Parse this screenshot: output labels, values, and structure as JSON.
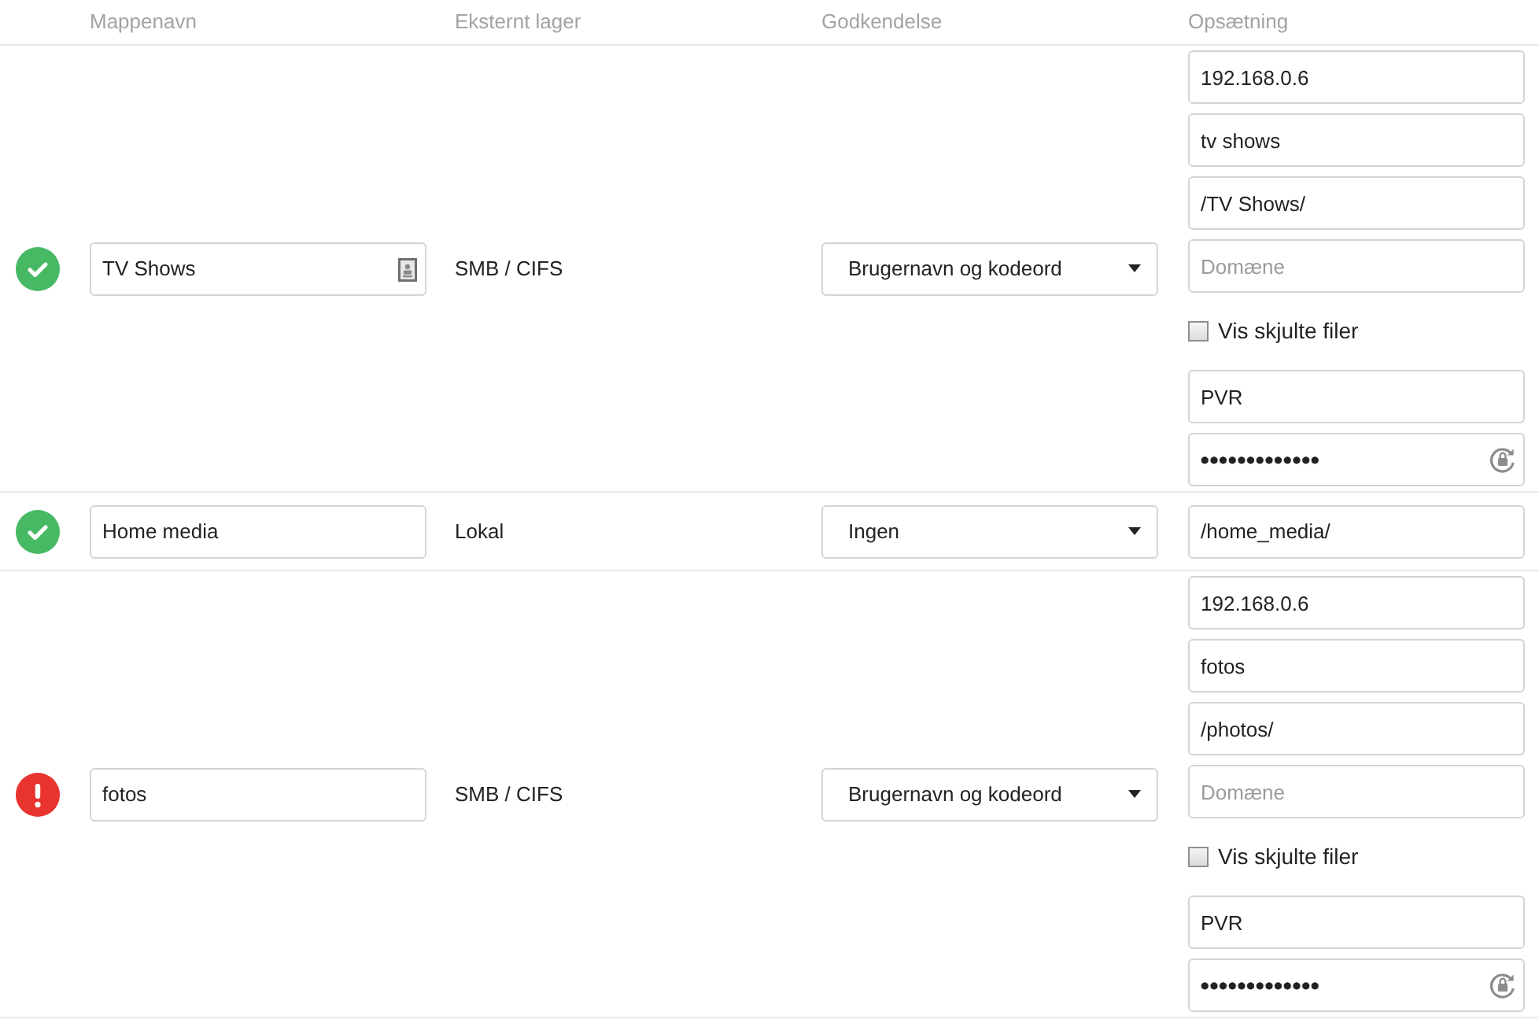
{
  "table": {
    "columns": [
      "Mappenavn",
      "Eksternt lager",
      "Godkendelse",
      "Opsætning"
    ],
    "rows": [
      {
        "error": false,
        "folder_name": {
          "value": "TV Shows",
          "contact_icon": true
        },
        "storage": "SMB / CIFS",
        "authentication": "Brugernavn og kodeord",
        "configuration": [
          {
            "kind": "text",
            "value": "192.168.0.6"
          },
          {
            "kind": "text",
            "value": "tv shows"
          },
          {
            "kind": "text",
            "value": "/TV Shows/"
          },
          {
            "kind": "text",
            "placeholder": "Domæne"
          },
          {
            "kind": "checkbox",
            "label": "Vis skjulte filer",
            "checked": false
          },
          {
            "kind": "text",
            "value": "PVR"
          },
          {
            "kind": "password",
            "value": "●●●●●●●●●●●●●"
          }
        ]
      },
      {
        "error": false,
        "folder_name": {
          "value": "Home media"
        },
        "storage": "Lokal",
        "authentication": "Ingen",
        "configuration": [
          {
            "kind": "text",
            "value": "/home_media/"
          }
        ]
      },
      {
        "error": true,
        "folder_name": {
          "value": "fotos"
        },
        "storage": "SMB / CIFS",
        "authentication": "Brugernavn og kodeord",
        "configuration": [
          {
            "kind": "text",
            "value": "192.168.0.6"
          },
          {
            "kind": "text",
            "value": "fotos"
          },
          {
            "kind": "text",
            "value": "/photos/"
          },
          {
            "kind": "text",
            "placeholder": "Domæne"
          },
          {
            "kind": "checkbox",
            "label": "Vis skjulte filer",
            "checked": false
          },
          {
            "kind": "text",
            "value": "PVR"
          },
          {
            "kind": "password",
            "value": "●●●●●●●●●●●●●"
          }
        ]
      }
    ]
  }
}
